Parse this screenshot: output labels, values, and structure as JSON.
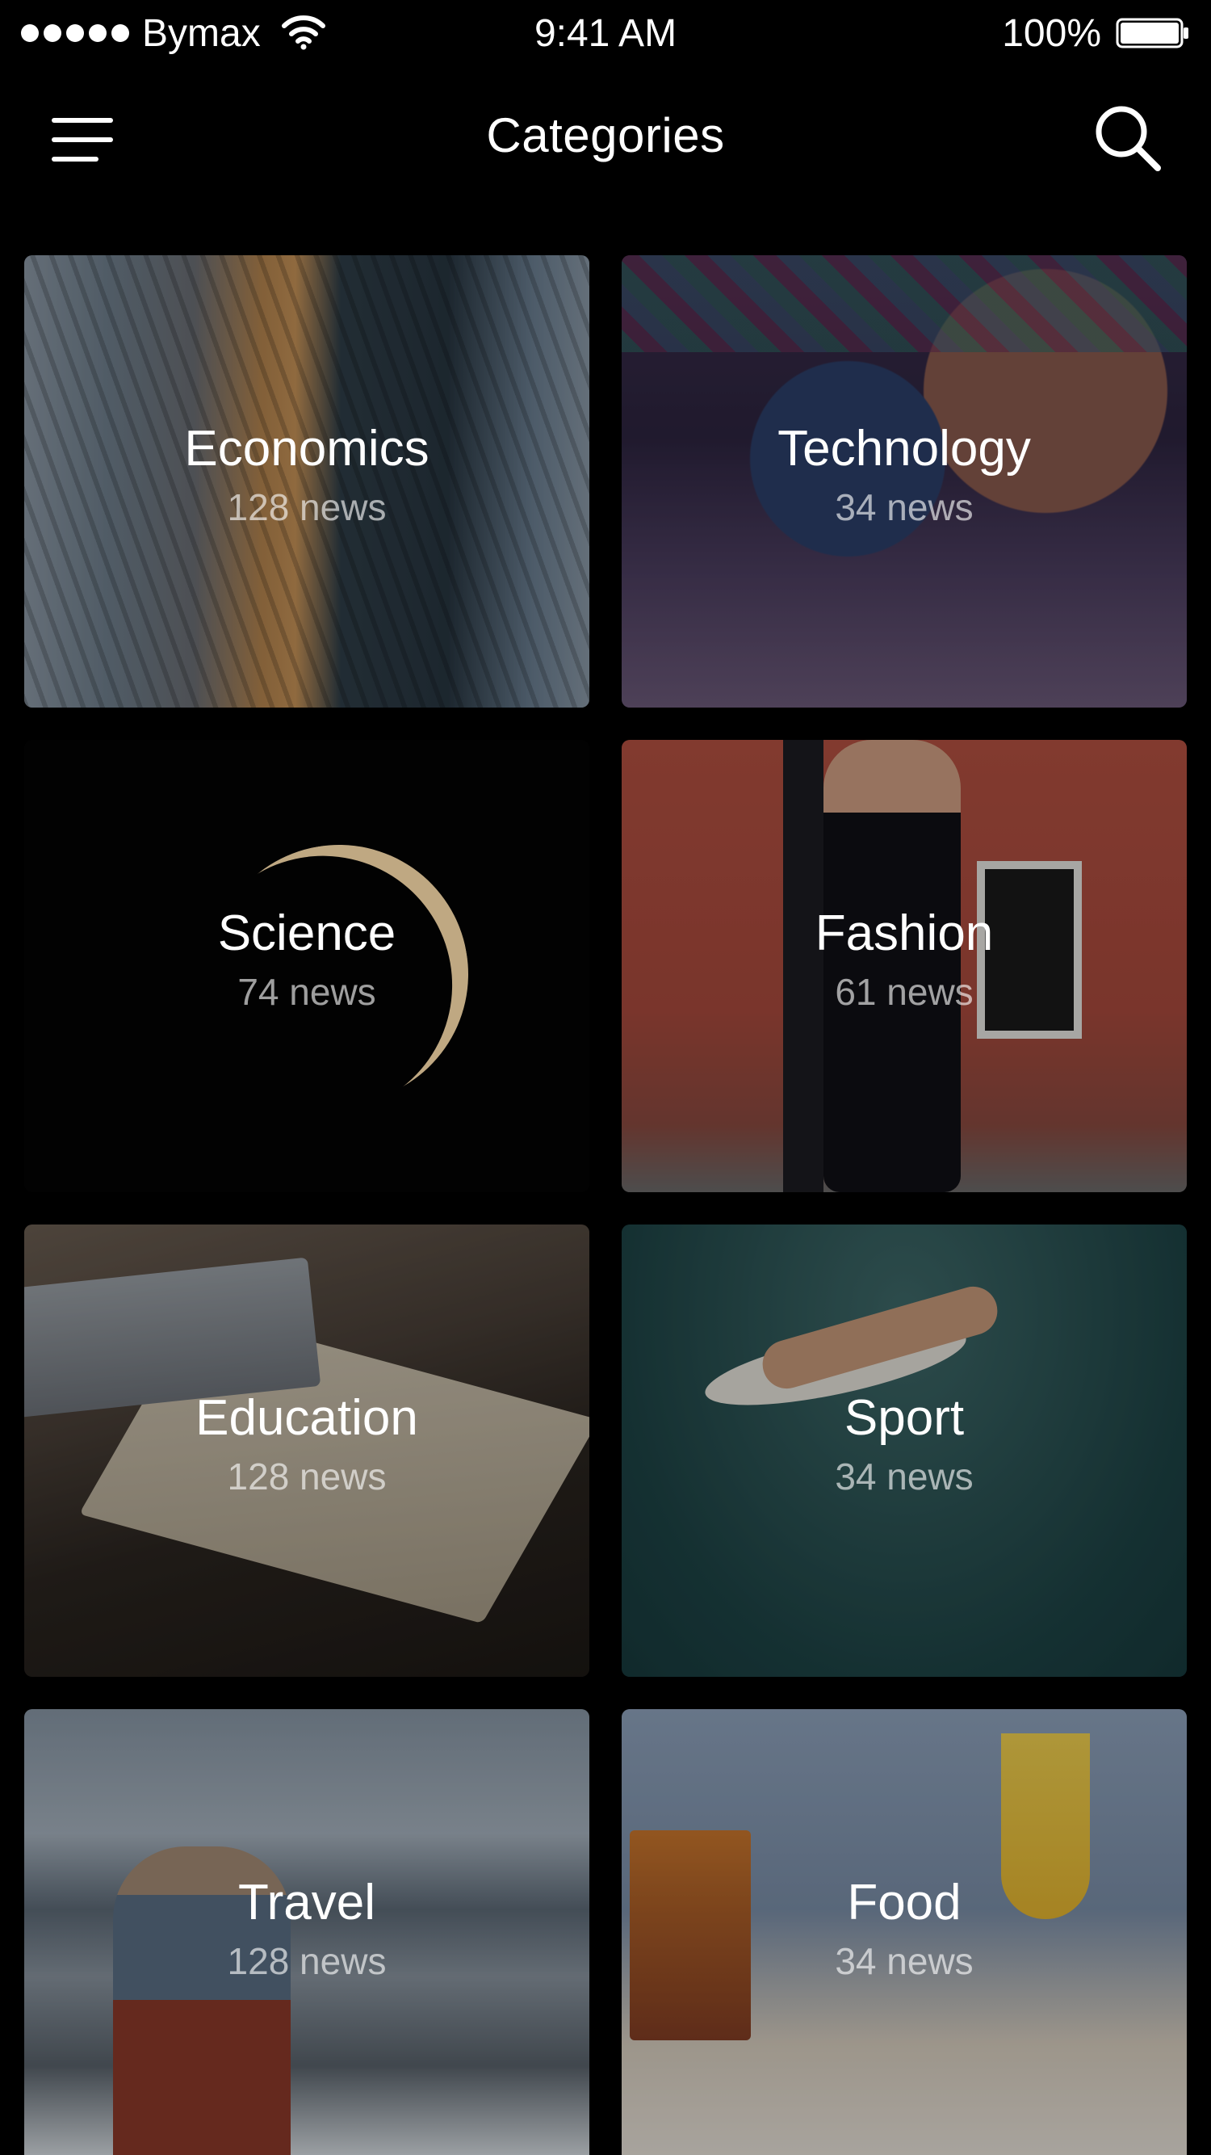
{
  "status_bar": {
    "carrier": "Bymax",
    "time": "9:41 AM",
    "battery": "100%",
    "battery_level": 1.0,
    "signal_bars": 5
  },
  "nav": {
    "title": "Categories",
    "menu_icon": "hamburger-menu-icon",
    "search_icon": "search-icon"
  },
  "categories": [
    {
      "name": "Economics",
      "count": "128 news"
    },
    {
      "name": "Technology",
      "count": "34 news"
    },
    {
      "name": "Science",
      "count": "74 news"
    },
    {
      "name": "Fashion",
      "count": "61 news"
    },
    {
      "name": "Education",
      "count": "128 news"
    },
    {
      "name": "Sport",
      "count": "34 news"
    },
    {
      "name": "Travel",
      "count": "128 news"
    },
    {
      "name": "Food",
      "count": "34 news"
    }
  ],
  "colors": {
    "background": "#000000",
    "text": "#ffffff",
    "subtext": "#9e9e9e"
  }
}
